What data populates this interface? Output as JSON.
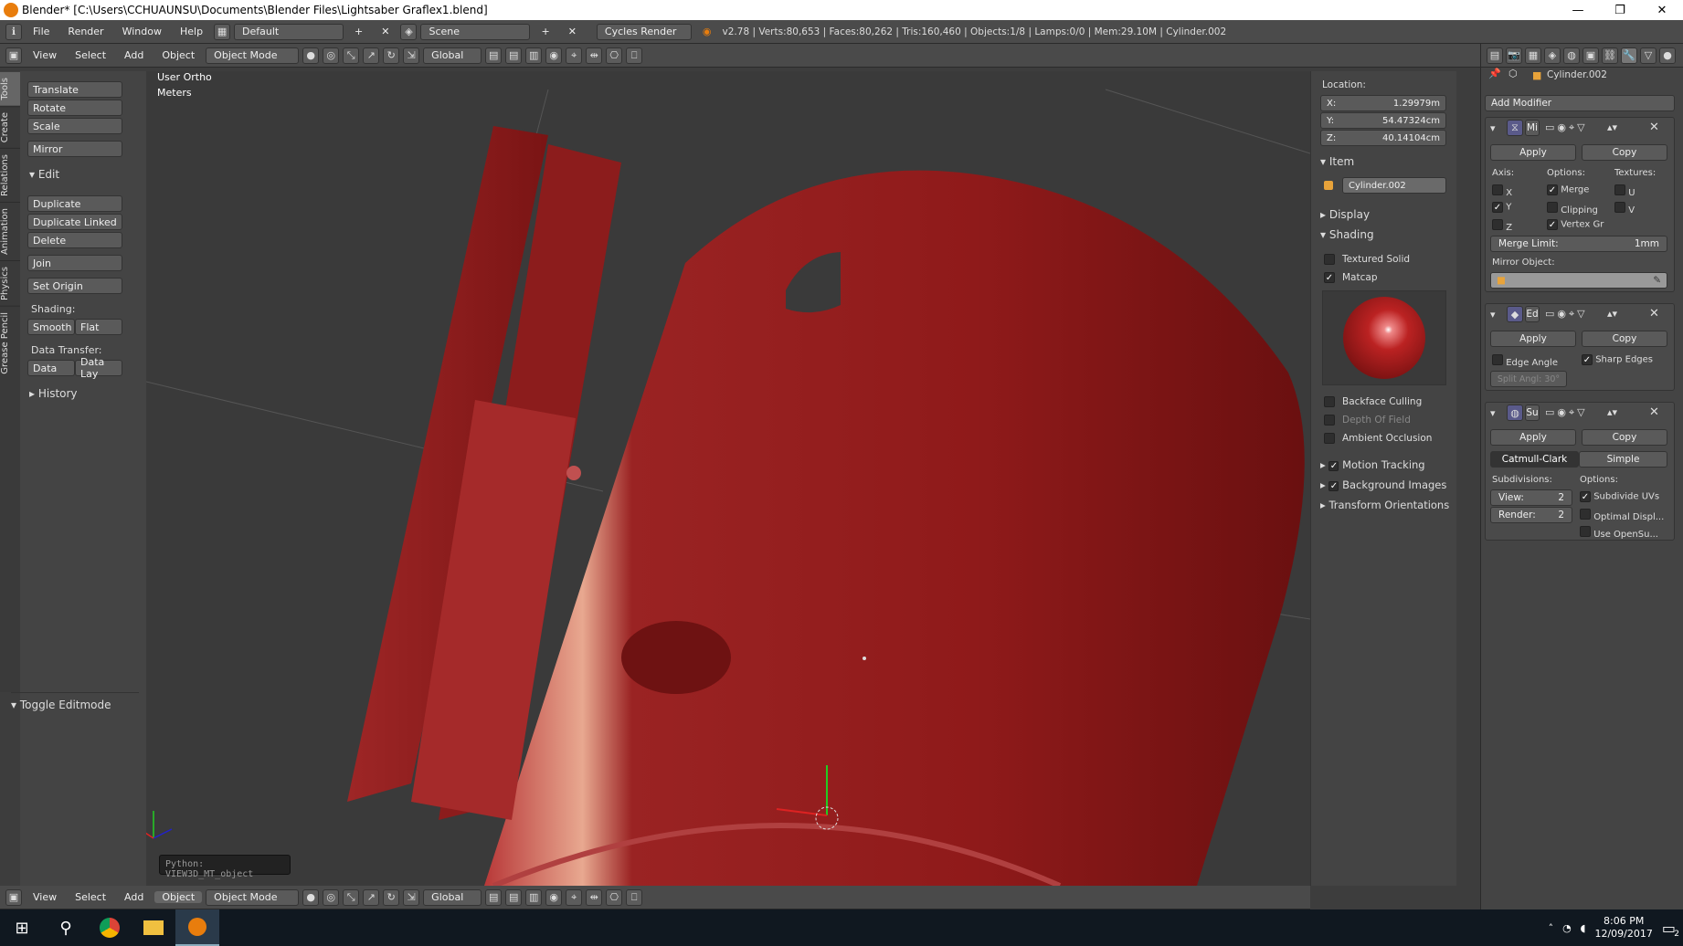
{
  "window": {
    "title": "Blender* [C:\\Users\\CCHUAUNSU\\Documents\\Blender Files\\Lightsaber Graflex1.blend]",
    "minimize": "—",
    "maximize": "❐",
    "close": "✕"
  },
  "info_header": {
    "menus": [
      "File",
      "Render",
      "Window",
      "Help"
    ],
    "screen_layout": "Default",
    "scene": "Scene",
    "render_engine": "Cycles Render",
    "stats": "v2.78 | Verts:80,653 | Faces:80,262 | Tris:160,460 | Objects:1/8 | Lamps:0/0 | Mem:29.10M | Cylinder.002"
  },
  "view_header": {
    "menus": [
      "View",
      "Select",
      "Add",
      "Object"
    ],
    "mode": "Object Mode",
    "orientation": "Global"
  },
  "tool_tabs": [
    "Tools",
    "Create",
    "Relations",
    "Animation",
    "Physics",
    "Grease Pencil"
  ],
  "tool_shelf": {
    "transform": [
      "Translate",
      "Rotate",
      "Scale"
    ],
    "mirror": "Mirror",
    "edit_title": "Edit",
    "edit": [
      "Duplicate",
      "Duplicate Linked",
      "Delete"
    ],
    "join": "Join",
    "set_origin": "Set Origin",
    "shading_label": "Shading:",
    "smooth": "Smooth",
    "flat": "Flat",
    "data_transfer_label": "Data Transfer:",
    "data": "Data",
    "data_lay": "Data Lay",
    "history": "History",
    "toggle_editmode": "Toggle Editmode"
  },
  "viewport": {
    "view_name": "User Ortho",
    "units": "Meters",
    "tooltip": "Python: VIEW3D_MT_object",
    "model_color": "#8f1a1a"
  },
  "n_panel": {
    "location_label": "Location:",
    "x": {
      "label": "X:",
      "value": "1.29979m"
    },
    "y": {
      "label": "Y:",
      "value": "54.47324cm"
    },
    "z": {
      "label": "Z:",
      "value": "40.14104cm"
    },
    "item_title": "Item",
    "object_name": "Cylinder.002",
    "display_title": "Display",
    "shading_title": "Shading",
    "textured_solid": "Textured Solid",
    "matcap": "Matcap",
    "backface_culling": "Backface Culling",
    "depth_of_field": "Depth Of Field",
    "ambient_occlusion": "Ambient Occlusion",
    "motion_tracking": "Motion Tracking",
    "background_images": "Background Images",
    "transform_orientations": "Transform Orientations"
  },
  "properties": {
    "object_name": "Cylinder.002",
    "add_modifier": "Add Modifier",
    "mirror": {
      "short": "Mi",
      "apply": "Apply",
      "copy": "Copy",
      "axis_label": "Axis:",
      "options_label": "Options:",
      "textures_label": "Textures:",
      "axes": [
        "X",
        "Y",
        "Z"
      ],
      "axes_checked": [
        false,
        true,
        false
      ],
      "options": [
        "Merge",
        "Clipping",
        "Vertex Gr"
      ],
      "options_checked": [
        true,
        false,
        true
      ],
      "textures": [
        "U",
        "V"
      ],
      "merge_limit_label": "Merge Limit:",
      "merge_limit": "1mm",
      "mirror_object_label": "Mirror Object:"
    },
    "edgesplit": {
      "short": "Ed",
      "apply": "Apply",
      "copy": "Copy",
      "edge_angle": "Edge Angle",
      "sharp_edges": "Sharp Edges",
      "split_angle": "Split Angl: 30°"
    },
    "subsurf": {
      "short": "Su",
      "apply": "Apply",
      "copy": "Copy",
      "catmull": "Catmull-Clark",
      "simple": "Simple",
      "subdivisions_label": "Subdivisions:",
      "options_label": "Options:",
      "view_label": "View:",
      "view_value": "2",
      "render_label": "Render:",
      "render_value": "2",
      "subdivide_uvs": "Subdivide UVs",
      "optimal_display": "Optimal Displ...",
      "use_opensubdiv": "Use OpenSu..."
    }
  },
  "taskbar": {
    "time": "8:06 PM",
    "date": "12/09/2017",
    "notifications": "2"
  }
}
